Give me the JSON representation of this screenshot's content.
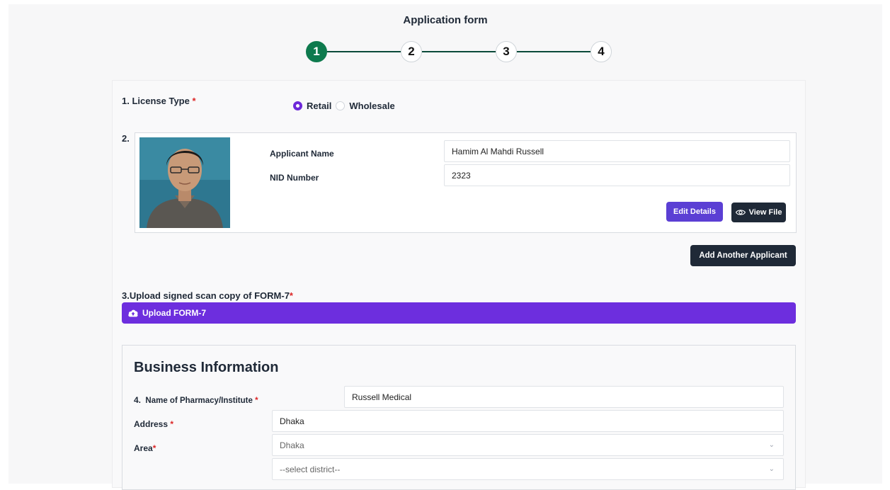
{
  "header": {
    "title": "Application form"
  },
  "stepper": {
    "steps": [
      "1",
      "2",
      "3",
      "4"
    ],
    "active_step": 1
  },
  "license": {
    "label": "1. License Type",
    "required_mark": "*",
    "options": [
      "Retail",
      "Wholesale"
    ],
    "selected": "Retail"
  },
  "applicant": {
    "index_label": "2.",
    "name_label": "Applicant Name",
    "name_value": "Hamim Al Mahdi Russell",
    "nid_label": "NID Number",
    "nid_value": "2323",
    "edit_button": "Edit Details",
    "view_button": "View File",
    "add_button": "Add Another Applicant"
  },
  "upload": {
    "label": "3.Upload signed scan copy of FORM-7",
    "required_mark": "*",
    "button": "Upload FORM-7"
  },
  "business": {
    "title": "Business Information",
    "pharmacy_label_num": "4.",
    "pharmacy_label": "Name of Pharmacy/Institute",
    "pharmacy_value": "Russell Medical",
    "address_label": "Address",
    "address_value": "Dhaka",
    "area_label": "Area",
    "area_value": "Dhaka",
    "district_placeholder": "--select district--",
    "required_mark": "*"
  },
  "colors": {
    "active_step": "#0e7a4e",
    "step_line": "#0b4a3a",
    "accent_purple": "#6d2ede",
    "edit_button": "#5b3fd4",
    "dark_button": "#1f2937",
    "required": "#dc2626"
  }
}
